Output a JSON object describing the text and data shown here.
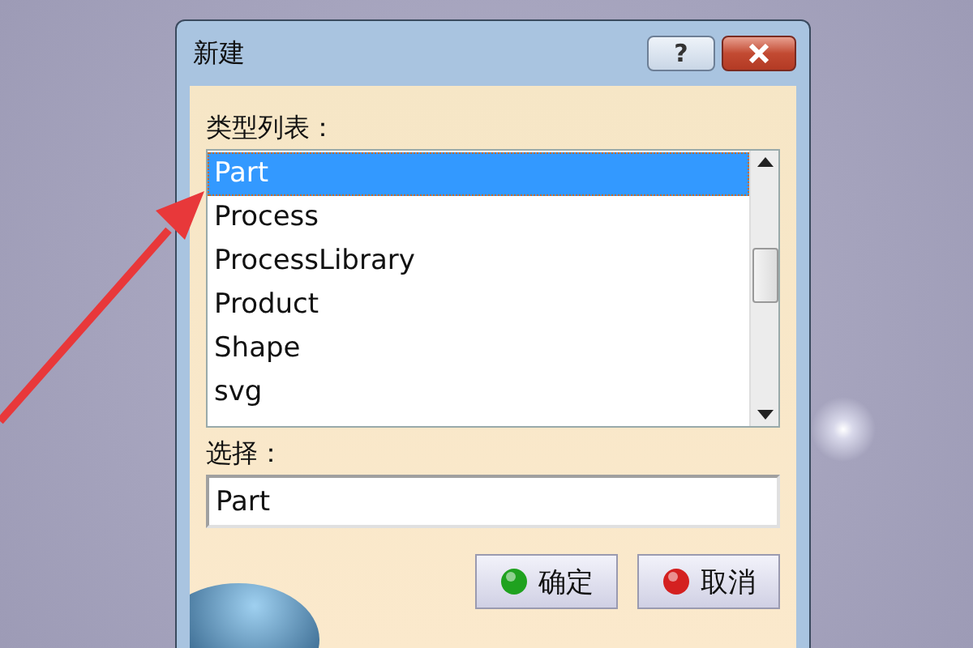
{
  "dialog": {
    "title": "新建",
    "help_button": "?"
  },
  "type_list": {
    "label": "类型列表：",
    "items": [
      {
        "text": "Part",
        "selected": true
      },
      {
        "text": "Process",
        "selected": false
      },
      {
        "text": "ProcessLibrary",
        "selected": false
      },
      {
        "text": "Product",
        "selected": false
      },
      {
        "text": "Shape",
        "selected": false
      },
      {
        "text": "svg",
        "selected": false
      }
    ]
  },
  "selection": {
    "label": "选择：",
    "value": "Part"
  },
  "buttons": [
    {
      "kind": "ok",
      "label": "确定"
    },
    {
      "kind": "cancel",
      "label": "取消"
    }
  ]
}
